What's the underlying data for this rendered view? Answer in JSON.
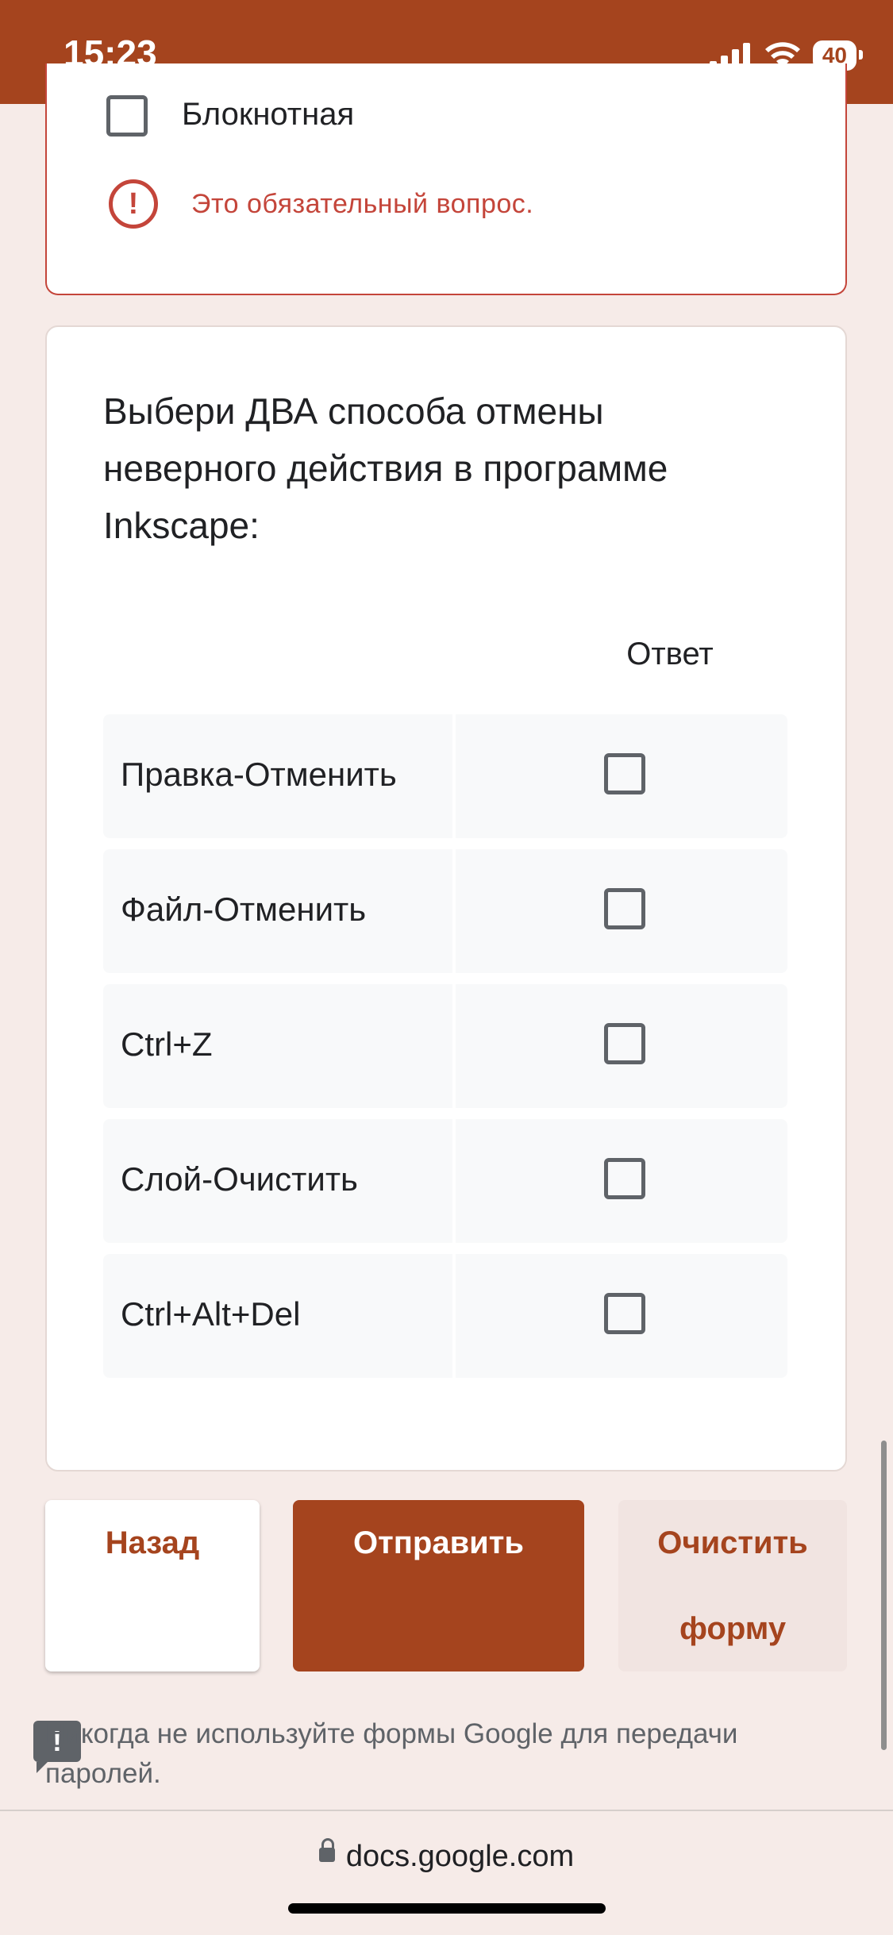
{
  "status": {
    "time": "15:23",
    "battery": "40"
  },
  "prev_question": {
    "option_label": "Блокнотная",
    "error_text": "Это обязательный вопрос.",
    "error_icon": "!"
  },
  "question": {
    "title": "Выбери ДВА способа отмены неверного действия в программе Inkscape:",
    "column_header": "Ответ",
    "rows": [
      {
        "label": "Правка-Отменить",
        "checked": false
      },
      {
        "label": "Файл-Отменить",
        "checked": false
      },
      {
        "label": "Ctrl+Z",
        "checked": false
      },
      {
        "label": "Слой-Очистить",
        "checked": false
      },
      {
        "label": "Ctrl+Alt+Del",
        "checked": false
      }
    ]
  },
  "buttons": {
    "back": "Назад",
    "submit": "Отправить",
    "clear_line1": "Очистить",
    "clear_line2": "форму"
  },
  "footer": {
    "note": "Никогда не используйте формы Google для передачи паролей.",
    "note_icon": "!"
  },
  "browser": {
    "url": "docs.google.com"
  },
  "colors": {
    "brand": "#a5441e",
    "error": "#c4453a",
    "background": "#f6ebe8"
  }
}
